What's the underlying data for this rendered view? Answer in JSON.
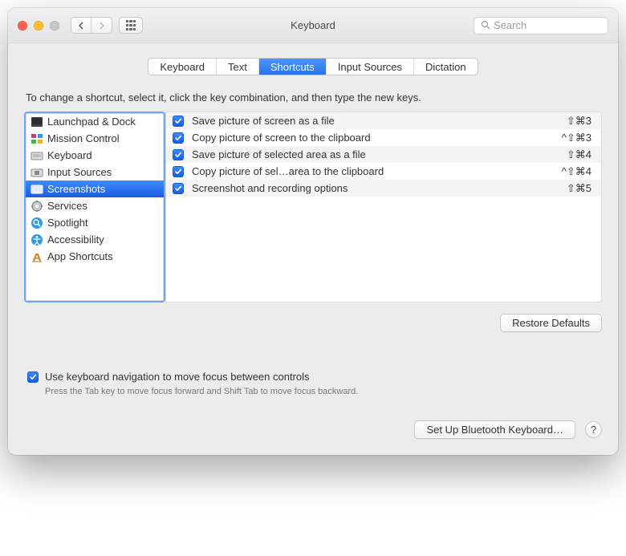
{
  "window": {
    "title": "Keyboard"
  },
  "search": {
    "placeholder": "Search"
  },
  "tabs": [
    {
      "label": "Keyboard",
      "selected": false
    },
    {
      "label": "Text",
      "selected": false
    },
    {
      "label": "Shortcuts",
      "selected": true
    },
    {
      "label": "Input Sources",
      "selected": false
    },
    {
      "label": "Dictation",
      "selected": false
    }
  ],
  "instruction": "To change a shortcut, select it, click the key combination, and then type the new keys.",
  "categories": [
    {
      "name": "Launchpad & Dock",
      "icon": "launchpad",
      "selected": false
    },
    {
      "name": "Mission Control",
      "icon": "mission",
      "selected": false
    },
    {
      "name": "Keyboard",
      "icon": "keyboard",
      "selected": false
    },
    {
      "name": "Input Sources",
      "icon": "input",
      "selected": false
    },
    {
      "name": "Screenshots",
      "icon": "screenshots",
      "selected": true
    },
    {
      "name": "Services",
      "icon": "services",
      "selected": false
    },
    {
      "name": "Spotlight",
      "icon": "spotlight",
      "selected": false
    },
    {
      "name": "Accessibility",
      "icon": "accessibility",
      "selected": false
    },
    {
      "name": "App Shortcuts",
      "icon": "appshortcuts",
      "selected": false
    }
  ],
  "shortcuts": [
    {
      "checked": true,
      "label": "Save picture of screen as a file",
      "keys": "⇧⌘3"
    },
    {
      "checked": true,
      "label": "Copy picture of screen to the clipboard",
      "keys": "^⇧⌘3"
    },
    {
      "checked": true,
      "label": "Save picture of selected area as a file",
      "keys": "⇧⌘4"
    },
    {
      "checked": true,
      "label": "Copy picture of sel…area to the clipboard",
      "keys": "^⇧⌘4"
    },
    {
      "checked": true,
      "label": "Screenshot and recording options",
      "keys": "⇧⌘5"
    }
  ],
  "restore_label": "Restore Defaults",
  "kb_nav": {
    "checked": true,
    "label": "Use keyboard navigation to move focus between controls",
    "hint": "Press the Tab key to move focus forward and Shift Tab to move focus backward."
  },
  "bluetooth_label": "Set Up Bluetooth Keyboard…",
  "help_label": "?"
}
